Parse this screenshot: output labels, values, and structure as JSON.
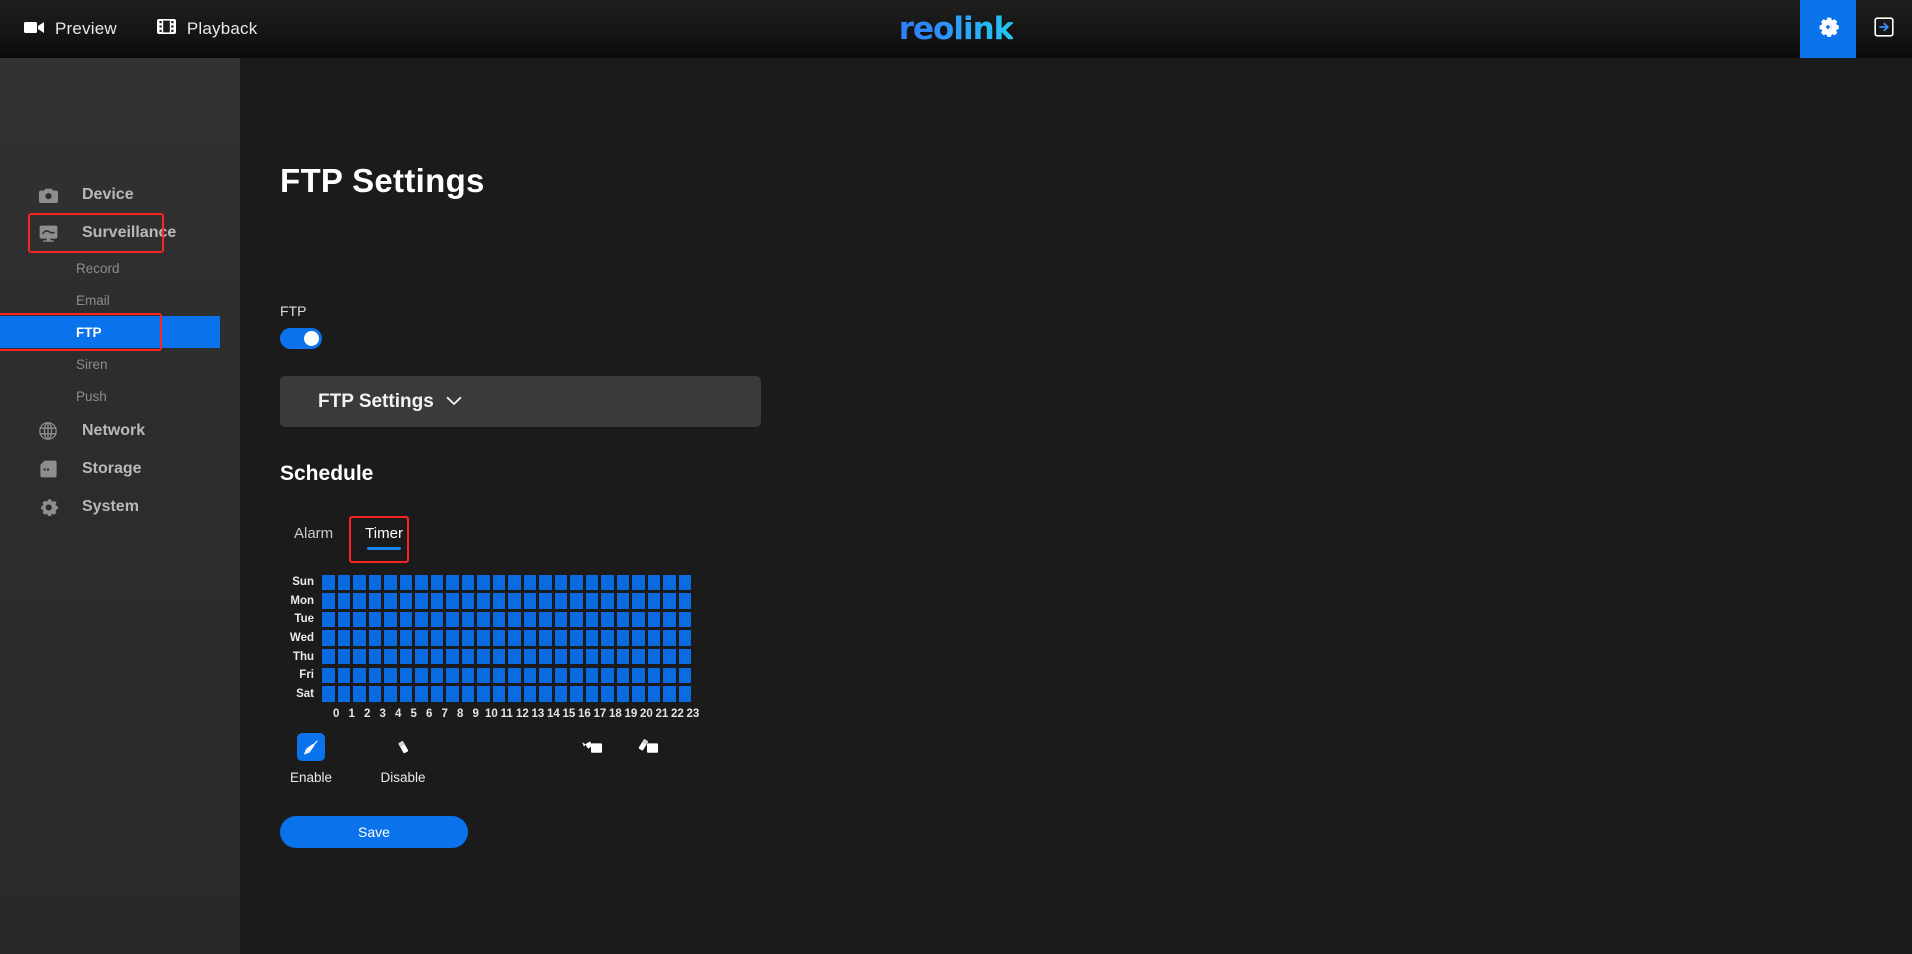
{
  "topbar": {
    "nav": [
      {
        "label": "Preview",
        "icon": "video-camera-icon"
      },
      {
        "label": "Playback",
        "icon": "film-strip-icon"
      }
    ],
    "logo": "reolink",
    "settings_icon": "gear-icon",
    "logout_icon": "logout-icon",
    "accent": "#0a72ea"
  },
  "sidebar": {
    "items": [
      {
        "label": "Device",
        "icon": "camera-icon",
        "type": "main"
      },
      {
        "label": "Surveillance",
        "icon": "monitor-icon",
        "type": "main",
        "highlighted": true
      },
      {
        "label": "Record",
        "type": "sub"
      },
      {
        "label": "Email",
        "type": "sub"
      },
      {
        "label": "FTP",
        "type": "sub",
        "selected": true,
        "highlighted": true
      },
      {
        "label": "Siren",
        "type": "sub"
      },
      {
        "label": "Push",
        "type": "sub"
      },
      {
        "label": "Network",
        "icon": "globe-icon",
        "type": "main"
      },
      {
        "label": "Storage",
        "icon": "sd-card-icon",
        "type": "main"
      },
      {
        "label": "System",
        "icon": "gear-icon",
        "type": "main"
      }
    ],
    "highlight_color": "#fb2323"
  },
  "main": {
    "title": "FTP Settings",
    "ftp_toggle": {
      "label": "FTP",
      "state": "on"
    },
    "panel": {
      "label": "FTP Settings",
      "icon": "chevron-down-icon",
      "expanded": false
    },
    "schedule": {
      "title": "Schedule",
      "tabs": [
        {
          "label": "Alarm",
          "active": false
        },
        {
          "label": "Timer",
          "active": true,
          "highlighted": true
        }
      ],
      "days": [
        "Sun",
        "Mon",
        "Tue",
        "Wed",
        "Thu",
        "Fri",
        "Sat"
      ],
      "hours": [
        "0",
        "1",
        "2",
        "3",
        "4",
        "5",
        "6",
        "7",
        "8",
        "9",
        "10",
        "11",
        "12",
        "13",
        "14",
        "15",
        "16",
        "17",
        "18",
        "19",
        "20",
        "21",
        "22",
        "23"
      ],
      "cells": [
        [
          1,
          1,
          1,
          1,
          1,
          1,
          1,
          1,
          1,
          1,
          1,
          1,
          1,
          1,
          1,
          1,
          1,
          1,
          1,
          1,
          1,
          1,
          1,
          1
        ],
        [
          1,
          1,
          1,
          1,
          1,
          1,
          1,
          1,
          1,
          1,
          1,
          1,
          1,
          1,
          1,
          1,
          1,
          1,
          1,
          1,
          1,
          1,
          1,
          1
        ],
        [
          1,
          1,
          1,
          1,
          1,
          1,
          1,
          1,
          1,
          1,
          1,
          1,
          1,
          1,
          1,
          1,
          1,
          1,
          1,
          1,
          1,
          1,
          1,
          1
        ],
        [
          1,
          1,
          1,
          1,
          1,
          1,
          1,
          1,
          1,
          1,
          1,
          1,
          1,
          1,
          1,
          1,
          1,
          1,
          1,
          1,
          1,
          1,
          1,
          1
        ],
        [
          1,
          1,
          1,
          1,
          1,
          1,
          1,
          1,
          1,
          1,
          1,
          1,
          1,
          1,
          1,
          1,
          1,
          1,
          1,
          1,
          1,
          1,
          1,
          1
        ],
        [
          1,
          1,
          1,
          1,
          1,
          1,
          1,
          1,
          1,
          1,
          1,
          1,
          1,
          1,
          1,
          1,
          1,
          1,
          1,
          1,
          1,
          1,
          1,
          1
        ],
        [
          1,
          1,
          1,
          1,
          1,
          1,
          1,
          1,
          1,
          1,
          1,
          1,
          1,
          1,
          1,
          1,
          1,
          1,
          1,
          1,
          1,
          1,
          1,
          1
        ]
      ],
      "cell_on_color": "#0a6be0",
      "tools": [
        {
          "label": "Enable",
          "icon": "brush-icon",
          "active": true
        },
        {
          "label": "Disable",
          "icon": "eraser-icon",
          "active": false
        }
      ],
      "bulk_tools": [
        {
          "icon": "fill-all-icon"
        },
        {
          "icon": "clear-all-icon"
        }
      ]
    },
    "save_label": "Save"
  }
}
